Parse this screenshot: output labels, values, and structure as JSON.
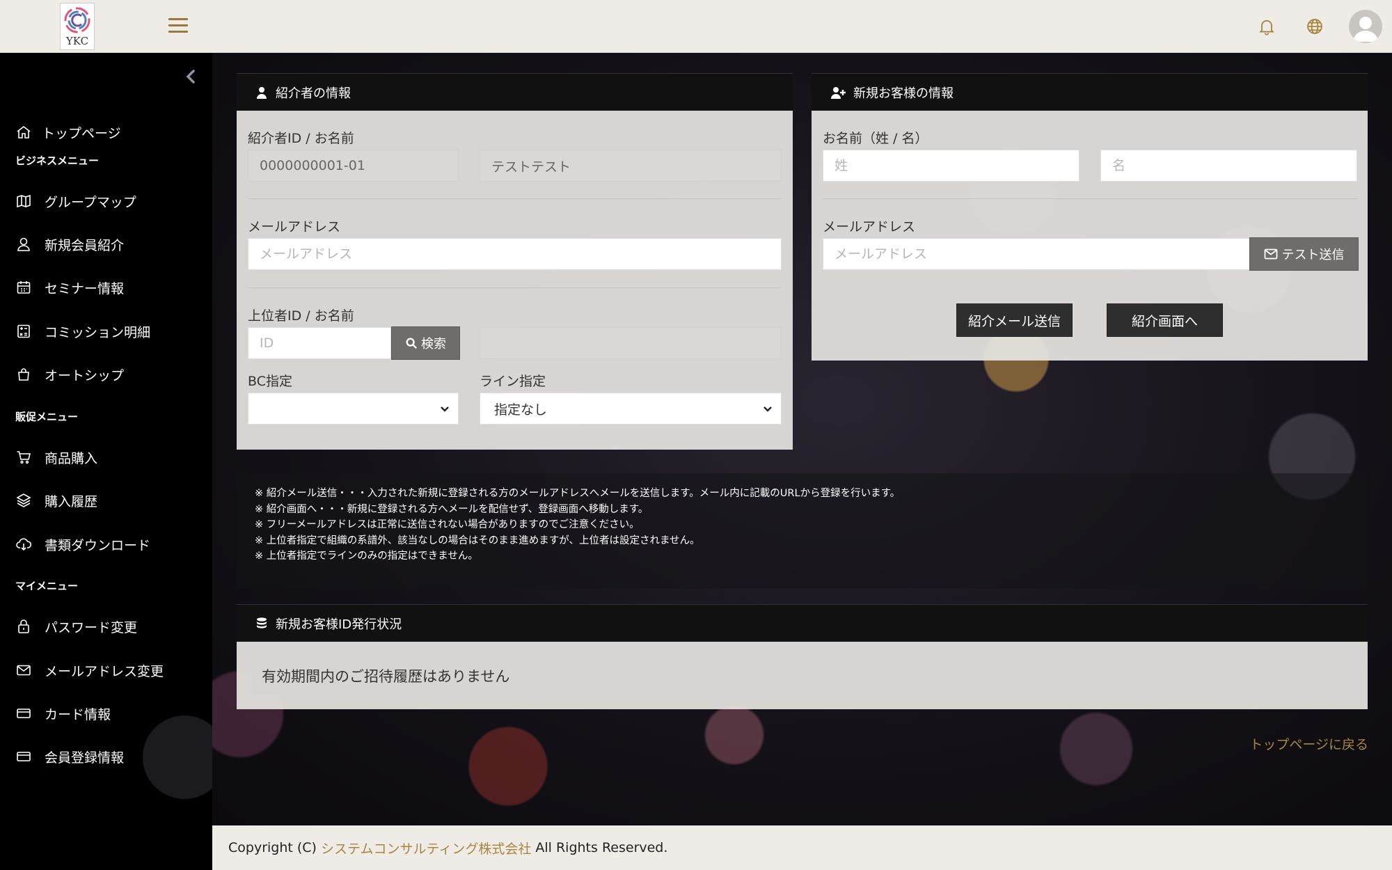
{
  "header": {
    "logo_text": "YKC",
    "menu_icon": "hamburger-menu-icon",
    "bell_icon": "bell-icon",
    "globe_icon": "globe-icon",
    "avatar_icon": "user-avatar-icon",
    "accent_color": "#a88640"
  },
  "sidebar": {
    "top_item": "トップページ",
    "sections": [
      {
        "title": "ビジネスメニュー",
        "items": [
          "グループマップ",
          "新規会員紹介",
          "セミナー情報",
          "コミッション明細",
          "オートシップ"
        ]
      },
      {
        "title": "販促メニュー",
        "items": [
          "商品購入",
          "購入履歴",
          "書類ダウンロード"
        ]
      },
      {
        "title": "マイメニュー",
        "items": [
          "パスワード変更",
          "メールアドレス変更",
          "カード情報",
          "会員登録情報"
        ]
      }
    ]
  },
  "introducer": {
    "title": "紹介者の情報",
    "id_name_label": "紹介者ID / お名前",
    "id_value": "0000000001-01",
    "name_value": "テストテスト",
    "email_label": "メールアドレス",
    "email_placeholder": "メールアドレス",
    "upline_label": "上位者ID / お名前",
    "upline_id_placeholder": "ID",
    "search_button": "検索",
    "bc_label": "BC指定",
    "bc_value": "",
    "line_label": "ライン指定",
    "line_value": "指定なし"
  },
  "new_customer": {
    "title": "新規お客様の情報",
    "name_label": "お名前（姓 / 名）",
    "last_name_placeholder": "姓",
    "first_name_placeholder": "名",
    "email_label": "メールアドレス",
    "email_placeholder": "メールアドレス",
    "test_send_button": "テスト送信",
    "send_mail_button": "紹介メール送信",
    "go_screen_button": "紹介画面へ"
  },
  "notes": [
    "※ 紹介メール送信・・・入力された新規に登録される方のメールアドレスへメールを送信します。メール内に記載のURLから登録を行います。",
    "※ 紹介画面へ・・・新規に登録される方へメールを配信せず、登録画面へ移動します。",
    "※ フリーメールアドレスは正常に送信されない場合がありますのでご注意ください。",
    "※ 上位者指定で組織の系譜外、該当なしの場合はそのまま進めますが、上位者は設定されません。",
    "※ 上位者指定でラインのみの指定はできません。"
  ],
  "status": {
    "title": "新規お客様ID発行状況",
    "empty_message": "有効期間内のご招待履歴はありません"
  },
  "back_link": "トップページに戻る",
  "footer": {
    "prefix": "Copyright (C)",
    "company": "システムコンサルティング株式会社",
    "suffix": "All Rights Reserved."
  }
}
